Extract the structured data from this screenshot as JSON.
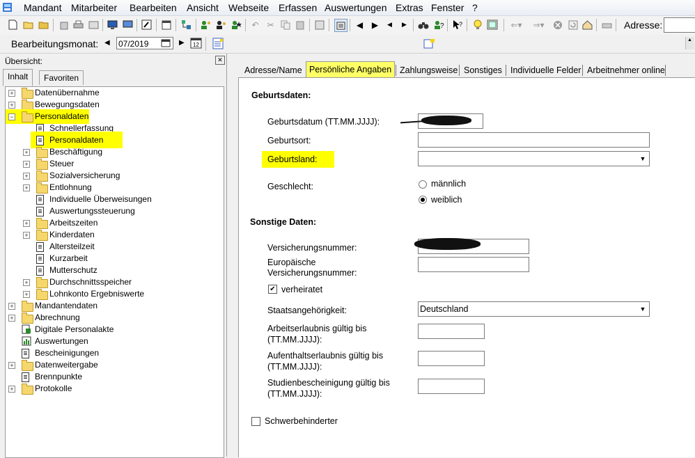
{
  "menu": [
    "Mandant",
    "Mitarbeiter",
    "Bearbeiten",
    "Ansicht",
    "Webseite",
    "Erfassen",
    "Auswertungen",
    "Extras",
    "Fenster",
    "?"
  ],
  "toolbar": {
    "address_label": "Adresse:"
  },
  "monthbar": {
    "label": "Bearbeitungsmonat:",
    "value": "07/2019"
  },
  "left": {
    "title": "Übersicht:",
    "tabs": [
      "Inhalt",
      "Favoriten"
    ],
    "tree": [
      "Datenübernahme",
      "Bewegungsdaten",
      "Personaldaten",
      "Schnellerfassung",
      "Personaldaten",
      "Beschäftigung",
      "Steuer",
      "Sozialversicherung",
      "Entlohnung",
      "Individuelle Überweisungen",
      "Auswertungssteuerung",
      "Arbeitszeiten",
      "Kinderdaten",
      "Altersteilzeit",
      "Kurzarbeit",
      "Mutterschutz",
      "Durchschnittsspeicher",
      "Lohnkonto Ergebniswerte",
      "Mandantendaten",
      "Abrechnung",
      "Digitale Personalakte",
      "Auswertungen",
      "Bescheinigungen",
      "Datenweitergabe",
      "Brennpunkte",
      "Protokolle"
    ]
  },
  "tabs": [
    "Adresse/Name",
    "Persönliche Angaben",
    "Zahlungsweise",
    "Sonstiges",
    "Individuelle Felder",
    "Arbeitnehmer online"
  ],
  "form": {
    "section_birth": "Geburtsdaten:",
    "birthdate_label": "Geburtsdatum (TT.MM.JJJJ):",
    "birthplace_label": "Geburtsort:",
    "birthcountry_label": "Geburtsland:",
    "gender_label": "Geschlecht:",
    "gender_male": "männlich",
    "gender_female": "weiblich",
    "section_other": "Sonstige Daten:",
    "insurance_label": "Versicherungsnummer:",
    "eu_insurance_label_1": "Europäische",
    "eu_insurance_label_2": "Versicherungsnummer:",
    "married_label": "verheiratet",
    "married_checked": true,
    "nationality_label": "Staatsangehörigkeit:",
    "nationality_value": "Deutschland",
    "work_permit_label_1": "Arbeitserlaubnis gültig bis",
    "work_permit_label_2": "(TT.MM.JJJJ):",
    "residence_permit_label_1": "Aufenthaltserlaubnis gültig bis",
    "residence_permit_label_2": "(TT.MM.JJJJ):",
    "study_cert_label_1": "Studienbescheinigung gültig bis",
    "study_cert_label_2": "(TT.MM.JJJJ):",
    "disabled_label": "Schwerbehinderter"
  },
  "colors": {
    "highlight": "#ffff00",
    "folder": "#f5d76e"
  }
}
